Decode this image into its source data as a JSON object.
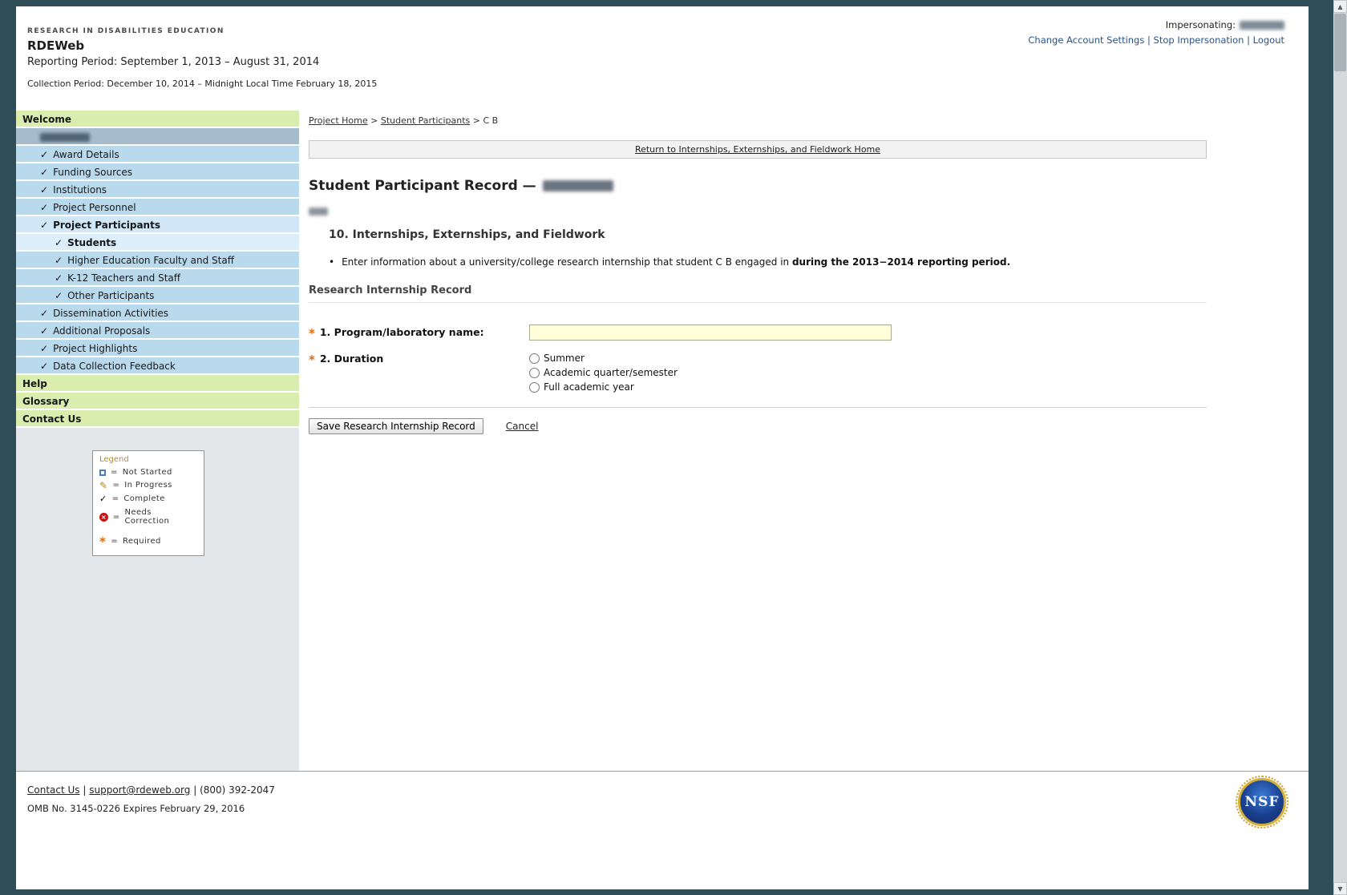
{
  "icons": {
    "check": "✓",
    "pencil": "✎",
    "cross": "×",
    "asterisk": "*",
    "bullet": "•",
    "scroll_up": "▲",
    "scroll_down": "▼"
  },
  "header": {
    "eyebrow": "RESEARCH IN DISABILITIES EDUCATION",
    "title": "RDEWeb",
    "reporting_period": "Reporting Period: September 1, 2013 – August 31, 2014",
    "collection_period": "Collection Period: December 10, 2014 – Midnight Local Time February 18, 2015",
    "impersonating_label": "Impersonating:",
    "link_separator": "|",
    "links": [
      "Change Account Settings",
      "Stop Impersonation",
      "Logout"
    ]
  },
  "sidebar": {
    "items": [
      {
        "id": "welcome",
        "label": "Welcome",
        "style": "green",
        "level": 0,
        "bold": true,
        "check": false
      },
      {
        "id": "award-number",
        "label": "",
        "style": "slate",
        "level": 1,
        "check": false,
        "redacted": true
      },
      {
        "id": "award-details",
        "label": "Award Details",
        "style": "blue",
        "level": 1,
        "check": true
      },
      {
        "id": "funding-sources",
        "label": "Funding Sources",
        "style": "blue",
        "level": 1,
        "check": true
      },
      {
        "id": "institutions",
        "label": "Institutions",
        "style": "blue",
        "level": 1,
        "check": true
      },
      {
        "id": "project-personnel",
        "label": "Project Personnel",
        "style": "blue",
        "level": 1,
        "check": true
      },
      {
        "id": "project-participants",
        "label": "Project Participants",
        "style": "selected",
        "level": 1,
        "check": true,
        "bold": true
      },
      {
        "id": "students",
        "label": "Students",
        "style": "selected-sub",
        "level": 2,
        "check": true,
        "bold": true
      },
      {
        "id": "higher-education-faculty-and-staff",
        "label": "Higher Education Faculty and Staff",
        "style": "blue",
        "level": 2,
        "check": true
      },
      {
        "id": "k12-teachers-and-staff",
        "label": "K-12 Teachers and Staff",
        "style": "blue",
        "level": 2,
        "check": true
      },
      {
        "id": "other-participants",
        "label": "Other Participants",
        "style": "blue",
        "level": 2,
        "check": true
      },
      {
        "id": "dissemination-activities",
        "label": "Dissemination Activities",
        "style": "blue",
        "level": 1,
        "check": true
      },
      {
        "id": "additional-proposals",
        "label": "Additional Proposals",
        "style": "blue",
        "level": 1,
        "check": true
      },
      {
        "id": "project-highlights",
        "label": "Project Highlights",
        "style": "blue",
        "level": 1,
        "check": true
      },
      {
        "id": "data-collection-feedback",
        "label": "Data Collection Feedback",
        "style": "blue",
        "level": 1,
        "check": true
      },
      {
        "id": "help",
        "label": "Help",
        "style": "green",
        "level": 0,
        "bold": true
      },
      {
        "id": "glossary",
        "label": "Glossary",
        "style": "green",
        "level": 0,
        "bold": true
      },
      {
        "id": "contact-us",
        "label": "Contact Us",
        "style": "green",
        "level": 0,
        "bold": true
      }
    ]
  },
  "legend": {
    "title": "Legend",
    "eq": "=",
    "items": [
      {
        "icon": "not-started-icon",
        "label": "Not Started"
      },
      {
        "icon": "in-progress-icon",
        "label": "In Progress"
      },
      {
        "icon": "complete-icon",
        "label": "Complete"
      },
      {
        "icon": "needs-correction-icon",
        "label": "Needs Correction"
      },
      {
        "icon": "required-icon",
        "label": "Required",
        "gap": true
      }
    ]
  },
  "breadcrumb": {
    "separator": ">",
    "items": [
      {
        "label": "Project Home",
        "link": true
      },
      {
        "label": "Student Participants",
        "link": true
      },
      {
        "label": "C B",
        "link": false
      }
    ]
  },
  "main": {
    "return_link": "Return to Internships, Externships, and Fieldwork Home",
    "record_title": "Student Participant Record —",
    "section_heading": "10. Internships, Externships, and Fieldwork",
    "bullet_text": "Enter information about a university/college research internship that student C B engaged in ",
    "bullet_text_bold": "during the 2013−2014 reporting period.",
    "subsection_heading": "Research Internship Record",
    "form": {
      "fields": [
        {
          "label": "1. Program/laboratory name:",
          "required": true,
          "type": "text",
          "value": ""
        },
        {
          "label": "2. Duration",
          "required": true,
          "type": "radio",
          "options": [
            "Summer",
            "Academic quarter/semester",
            "Full academic year"
          ]
        }
      ],
      "save_label": "Save Research Internship Record",
      "cancel_label": "Cancel"
    }
  },
  "footer": {
    "contact_link": "Contact Us",
    "separator": "|",
    "email_link": "support@rdeweb.org",
    "phone": "(800) 392-2047",
    "omb": "OMB No. 3145-0226 Expires February 29, 2016",
    "nsf_label": "NSF"
  }
}
